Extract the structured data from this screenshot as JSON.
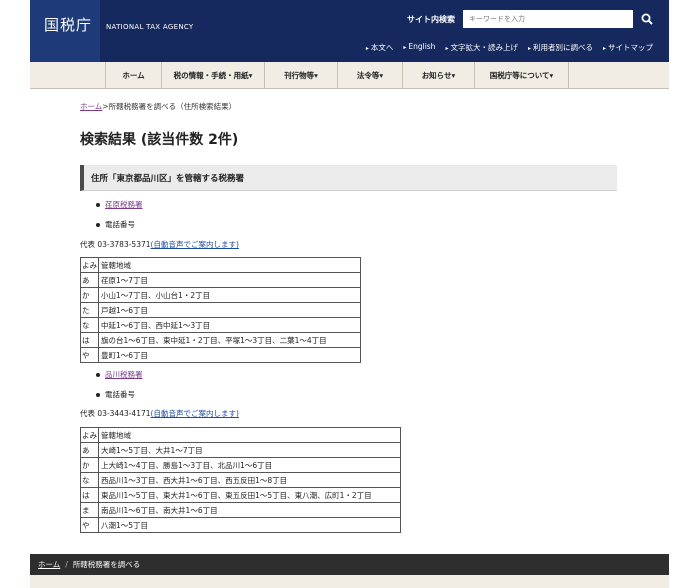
{
  "header": {
    "logo": "国税庁",
    "agency_name": "NATIONAL TAX AGENCY",
    "search_label": "サイト内検索",
    "search_placeholder": "キーワードを入力",
    "util_links": [
      "本文へ",
      "English",
      "文字拡大・読み上げ",
      "利用者別に調べる",
      "サイトマップ"
    ]
  },
  "nav": {
    "items": [
      "ホーム",
      "税の情報・手続・用紙▾",
      "刊行物等▾",
      "法令等▾",
      "お知らせ▾",
      "国税庁等について▾"
    ]
  },
  "breadcrumb": {
    "home": "ホーム",
    "separator": ">",
    "current": "所轄税務署を調べる（住所検索結果）"
  },
  "page_title": "検索結果 (該当件数 2件)",
  "section_heading": "住所「東京都品川区」を管轄する税務署",
  "phone_label": "電話番号",
  "offices": [
    {
      "name": "荏原税務署",
      "phone_prefix": "代表 03-3783-5371",
      "phone_auto": "(自動音声でご案内します)",
      "table_header": [
        "よみ",
        "管轄地域"
      ],
      "rows": [
        [
          "あ",
          "荏原1～7丁目"
        ],
        [
          "か",
          "小山1～7丁目、小山台1・2丁目"
        ],
        [
          "た",
          "戸越1～6丁目"
        ],
        [
          "な",
          "中延1～6丁目、西中延1～3丁目"
        ],
        [
          "は",
          "旗の台1～6丁目、東中延1・2丁目、平塚1～3丁目、二葉1～4丁目"
        ],
        [
          "や",
          "豊町1～6丁目"
        ]
      ]
    },
    {
      "name": "品川税務署",
      "phone_prefix": "代表 03-3443-4171",
      "phone_auto": "(自動音声でご案内します)",
      "table_header": [
        "よみ",
        "管轄地域"
      ],
      "rows": [
        [
          "あ",
          "大崎1～5丁目、大井1～7丁目"
        ],
        [
          "か",
          "上大崎1～4丁目、勝島1～3丁目、北品川1～6丁目"
        ],
        [
          "な",
          "西品川1～3丁目、西大井1～6丁目、西五反田1～8丁目"
        ],
        [
          "は",
          "東品川1～5丁目、東大井1～6丁目、東五反田1～5丁目、東八潮、広町1・2丁目"
        ],
        [
          "ま",
          "南品川1～6丁目、南大井1～6丁目"
        ],
        [
          "や",
          "八潮1～5丁目"
        ]
      ]
    }
  ],
  "footer_breadcrumb": {
    "home": "ホーム",
    "separator": "/",
    "current": "所轄税務署を調べる"
  },
  "colors": {
    "header_bg": "#15295e",
    "nav_bg": "#f1ece4",
    "visited_link": "#7a3a8a",
    "link": "#1f4c9f",
    "footer_bg": "#2e2e2e"
  }
}
